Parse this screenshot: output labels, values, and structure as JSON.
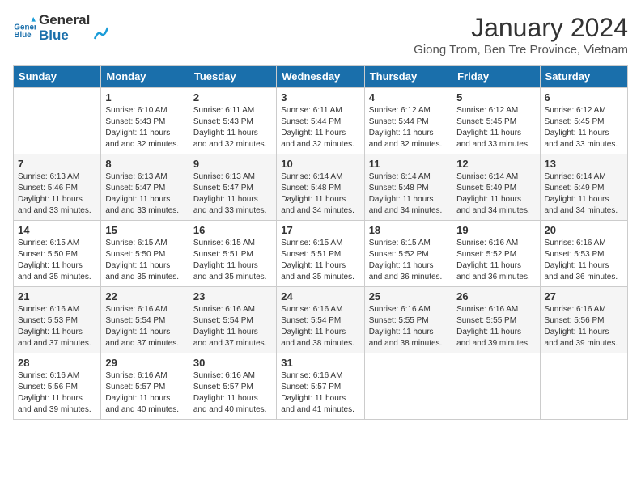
{
  "header": {
    "logo_line1": "General",
    "logo_line2": "Blue",
    "month_year": "January 2024",
    "location": "Giong Trom, Ben Tre Province, Vietnam"
  },
  "days_of_week": [
    "Sunday",
    "Monday",
    "Tuesday",
    "Wednesday",
    "Thursday",
    "Friday",
    "Saturday"
  ],
  "weeks": [
    [
      {
        "day": null
      },
      {
        "day": "1",
        "sunrise": "6:10 AM",
        "sunset": "5:43 PM",
        "daylight": "11 hours and 32 minutes."
      },
      {
        "day": "2",
        "sunrise": "6:11 AM",
        "sunset": "5:43 PM",
        "daylight": "11 hours and 32 minutes."
      },
      {
        "day": "3",
        "sunrise": "6:11 AM",
        "sunset": "5:44 PM",
        "daylight": "11 hours and 32 minutes."
      },
      {
        "day": "4",
        "sunrise": "6:12 AM",
        "sunset": "5:44 PM",
        "daylight": "11 hours and 32 minutes."
      },
      {
        "day": "5",
        "sunrise": "6:12 AM",
        "sunset": "5:45 PM",
        "daylight": "11 hours and 33 minutes."
      },
      {
        "day": "6",
        "sunrise": "6:12 AM",
        "sunset": "5:45 PM",
        "daylight": "11 hours and 33 minutes."
      }
    ],
    [
      {
        "day": "7",
        "sunrise": "6:13 AM",
        "sunset": "5:46 PM",
        "daylight": "11 hours and 33 minutes."
      },
      {
        "day": "8",
        "sunrise": "6:13 AM",
        "sunset": "5:47 PM",
        "daylight": "11 hours and 33 minutes."
      },
      {
        "day": "9",
        "sunrise": "6:13 AM",
        "sunset": "5:47 PM",
        "daylight": "11 hours and 33 minutes."
      },
      {
        "day": "10",
        "sunrise": "6:14 AM",
        "sunset": "5:48 PM",
        "daylight": "11 hours and 34 minutes."
      },
      {
        "day": "11",
        "sunrise": "6:14 AM",
        "sunset": "5:48 PM",
        "daylight": "11 hours and 34 minutes."
      },
      {
        "day": "12",
        "sunrise": "6:14 AM",
        "sunset": "5:49 PM",
        "daylight": "11 hours and 34 minutes."
      },
      {
        "day": "13",
        "sunrise": "6:14 AM",
        "sunset": "5:49 PM",
        "daylight": "11 hours and 34 minutes."
      }
    ],
    [
      {
        "day": "14",
        "sunrise": "6:15 AM",
        "sunset": "5:50 PM",
        "daylight": "11 hours and 35 minutes."
      },
      {
        "day": "15",
        "sunrise": "6:15 AM",
        "sunset": "5:50 PM",
        "daylight": "11 hours and 35 minutes."
      },
      {
        "day": "16",
        "sunrise": "6:15 AM",
        "sunset": "5:51 PM",
        "daylight": "11 hours and 35 minutes."
      },
      {
        "day": "17",
        "sunrise": "6:15 AM",
        "sunset": "5:51 PM",
        "daylight": "11 hours and 35 minutes."
      },
      {
        "day": "18",
        "sunrise": "6:15 AM",
        "sunset": "5:52 PM",
        "daylight": "11 hours and 36 minutes."
      },
      {
        "day": "19",
        "sunrise": "6:16 AM",
        "sunset": "5:52 PM",
        "daylight": "11 hours and 36 minutes."
      },
      {
        "day": "20",
        "sunrise": "6:16 AM",
        "sunset": "5:53 PM",
        "daylight": "11 hours and 36 minutes."
      }
    ],
    [
      {
        "day": "21",
        "sunrise": "6:16 AM",
        "sunset": "5:53 PM",
        "daylight": "11 hours and 37 minutes."
      },
      {
        "day": "22",
        "sunrise": "6:16 AM",
        "sunset": "5:54 PM",
        "daylight": "11 hours and 37 minutes."
      },
      {
        "day": "23",
        "sunrise": "6:16 AM",
        "sunset": "5:54 PM",
        "daylight": "11 hours and 37 minutes."
      },
      {
        "day": "24",
        "sunrise": "6:16 AM",
        "sunset": "5:54 PM",
        "daylight": "11 hours and 38 minutes."
      },
      {
        "day": "25",
        "sunrise": "6:16 AM",
        "sunset": "5:55 PM",
        "daylight": "11 hours and 38 minutes."
      },
      {
        "day": "26",
        "sunrise": "6:16 AM",
        "sunset": "5:55 PM",
        "daylight": "11 hours and 39 minutes."
      },
      {
        "day": "27",
        "sunrise": "6:16 AM",
        "sunset": "5:56 PM",
        "daylight": "11 hours and 39 minutes."
      }
    ],
    [
      {
        "day": "28",
        "sunrise": "6:16 AM",
        "sunset": "5:56 PM",
        "daylight": "11 hours and 39 minutes."
      },
      {
        "day": "29",
        "sunrise": "6:16 AM",
        "sunset": "5:57 PM",
        "daylight": "11 hours and 40 minutes."
      },
      {
        "day": "30",
        "sunrise": "6:16 AM",
        "sunset": "5:57 PM",
        "daylight": "11 hours and 40 minutes."
      },
      {
        "day": "31",
        "sunrise": "6:16 AM",
        "sunset": "5:57 PM",
        "daylight": "11 hours and 41 minutes."
      },
      {
        "day": null
      },
      {
        "day": null
      },
      {
        "day": null
      }
    ]
  ]
}
